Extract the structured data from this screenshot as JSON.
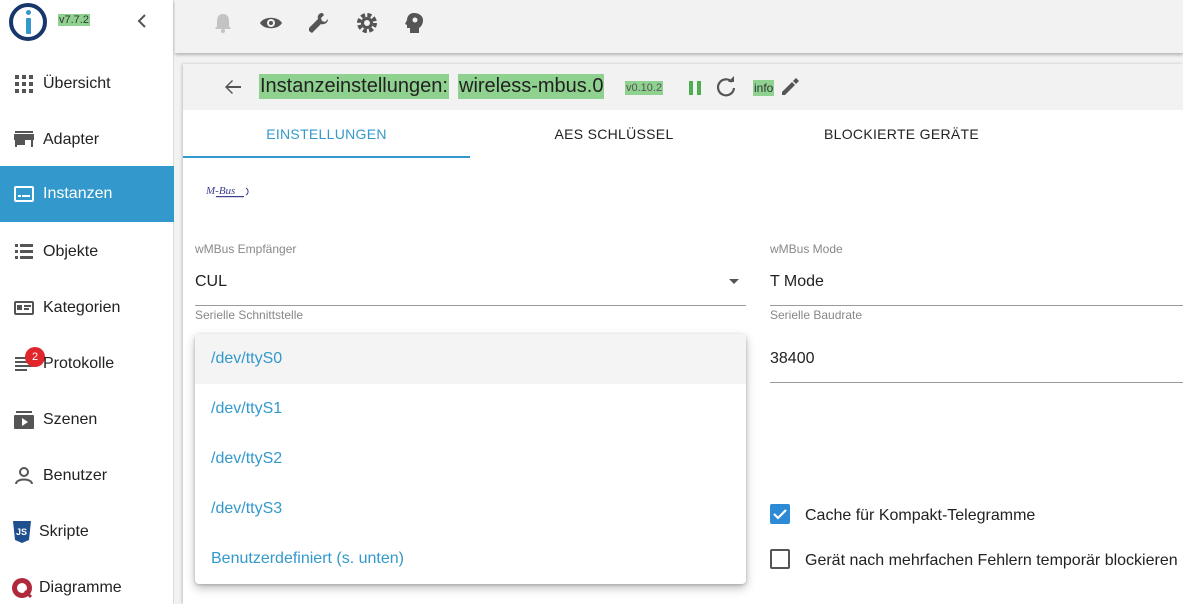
{
  "app": {
    "version": "v7.7.2"
  },
  "sidebar": {
    "items": [
      {
        "label": "Übersicht",
        "icon": "apps-grid-icon"
      },
      {
        "label": "Adapter",
        "icon": "store-icon"
      },
      {
        "label": "Instanzen",
        "icon": "instances-icon",
        "active": true
      },
      {
        "label": "Objekte",
        "icon": "list-icon"
      },
      {
        "label": "Kategorien",
        "icon": "categories-icon"
      },
      {
        "label": "Protokolle",
        "icon": "log-lines-icon",
        "badge": "2"
      },
      {
        "label": "Szenen",
        "icon": "scenes-icon"
      },
      {
        "label": "Benutzer",
        "icon": "user-icon"
      },
      {
        "label": "Skripte",
        "icon": "javascript-icon"
      },
      {
        "label": "Diagramme",
        "icon": "chart-icon"
      }
    ]
  },
  "topbar": {
    "icons": [
      "bell-icon",
      "eye-icon",
      "wrench-icon",
      "gear-icon",
      "expert-head-icon"
    ]
  },
  "page": {
    "title_prefix": "Instanzeinstellungen:",
    "instance": "wireless-mbus.0",
    "adapter_version": "v0.10.2",
    "info_label": "info"
  },
  "tabs": [
    {
      "label": "EINSTELLUNGEN",
      "active": true
    },
    {
      "label": "AES SCHLÜSSEL"
    },
    {
      "label": "BLOCKIERTE GERÄTE"
    }
  ],
  "logo_text": "M-Bus",
  "form": {
    "receiver": {
      "label": "wMBus Empfänger",
      "value": "CUL"
    },
    "mode": {
      "label": "wMBus Mode",
      "value": "T Mode"
    },
    "serial_port": {
      "label": "Serielle Schnittstelle"
    },
    "baudrate": {
      "label": "Serielle Baudrate",
      "value": "38400"
    },
    "cache_checkbox": {
      "label": "Cache für Kompakt-Telegramme",
      "checked": true
    },
    "block_checkbox": {
      "label": "Gerät nach mehrfachen Fehlern temporär blockieren",
      "checked": false
    }
  },
  "dropdown": {
    "options": [
      "/dev/ttyS0",
      "/dev/ttyS1",
      "/dev/ttyS2",
      "/dev/ttyS3",
      "Benutzerdefiniert (s. unten)"
    ],
    "highlighted": "/dev/ttyS0"
  },
  "colors": {
    "accent": "#3399cc",
    "highlight": "#8fd18f",
    "badge": "#e0262b",
    "checkbox": "#2d8ad6",
    "pause_icon": "#4caf50"
  }
}
